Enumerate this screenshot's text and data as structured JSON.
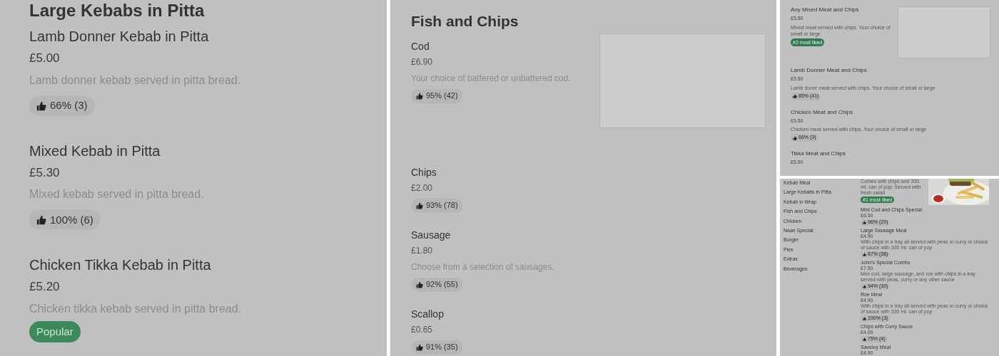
{
  "kebab_section": {
    "heading": "Large Kebabs in Pitta",
    "items": [
      {
        "name": "Lamb Donner Kebab in Pitta",
        "price": "£5.00",
        "description": "Lamb donner kebab served in pitta bread.",
        "rating": "66% (3)"
      },
      {
        "name": "Mixed Kebab in Pitta",
        "price": "£5.30",
        "description": "Mixed kebab served in pitta bread.",
        "rating": "100% (6)"
      },
      {
        "name": "Chicken Tikka Kebab in Pitta",
        "price": "£5.20",
        "description": "Chicken tikka kebab served in pitta bread.",
        "badge": "Popular"
      }
    ]
  },
  "fish_section": {
    "heading": "Fish and Chips",
    "items": [
      {
        "name": "Cod",
        "price": "£6.90",
        "description": "Your choice of battered or unbattered cod.",
        "rating": "95% (42)",
        "image": true
      },
      {
        "name": "Chips",
        "price": "£2.00",
        "rating": "93% (78)"
      },
      {
        "name": "Sausage",
        "price": "£1.80",
        "description": "Choose from a selection of sausages.",
        "rating": "92% (55)"
      },
      {
        "name": "Scallop",
        "price": "£0.65",
        "rating": "91% (35)"
      }
    ]
  },
  "meat_section": {
    "items": [
      {
        "name": "Any Mixed Meat and Chips",
        "price": "£5.50",
        "description": "Mixed meat served with chips. Your choice of small or large",
        "badge": "#2 most liked",
        "image": true
      },
      {
        "name": "Lamb Donner Meat and Chips",
        "price": "£5.50",
        "description": "Lamb doner meat served with chips. Your choice of small or large",
        "rating": "85% (41)"
      },
      {
        "name": "Chicken Meat and Chips",
        "price": "£5.50",
        "description": "Chicken meat served with chips. Your choice of small or large",
        "rating": "66% (3)"
      },
      {
        "name": "Tikka Meat and Chips",
        "price": "£5.50"
      }
    ]
  },
  "menu_page": {
    "sidebar": {
      "items": [
        "Kebab Meal",
        "Large Kebabs in Pitta",
        "Kebab in Wrap",
        "Fish and Chips",
        "Chicken",
        "Naan Special",
        "Burger",
        "Pies",
        "Extras",
        "Beverages"
      ]
    },
    "items": [
      {
        "description": "Comes with chips and 330 ml. can of pop. Served with fresh salad",
        "badge": "#1 most liked",
        "photo": true
      },
      {
        "name": "Mini Cod and Chips Special",
        "price": "£6.50",
        "rating": "96% (20)"
      },
      {
        "name": "Large Sausage Meal",
        "price": "£4.90",
        "description": "With chips in a tray all served with peas or curry or choice of sauce with 330 ml. can of pop",
        "rating": "87% (38)"
      },
      {
        "name": "John's Special Combo",
        "price": "£7.50",
        "description": "Mini cod, large sausage, and roe with chips in a tray served with peas, curry or any other sauce",
        "rating": "94% (30)"
      },
      {
        "name": "Roe Meal",
        "price": "£4.90",
        "description": "With chips in a tray all served with peas or curry or choice of sauce with 330 ml. can of pop",
        "rating": "100% (3)"
      },
      {
        "name": "Chips with Curry Sauce",
        "price": "£4.00",
        "rating": "75% (4)"
      },
      {
        "name": "Saveloy Meal",
        "price": "£4.90"
      }
    ]
  }
}
